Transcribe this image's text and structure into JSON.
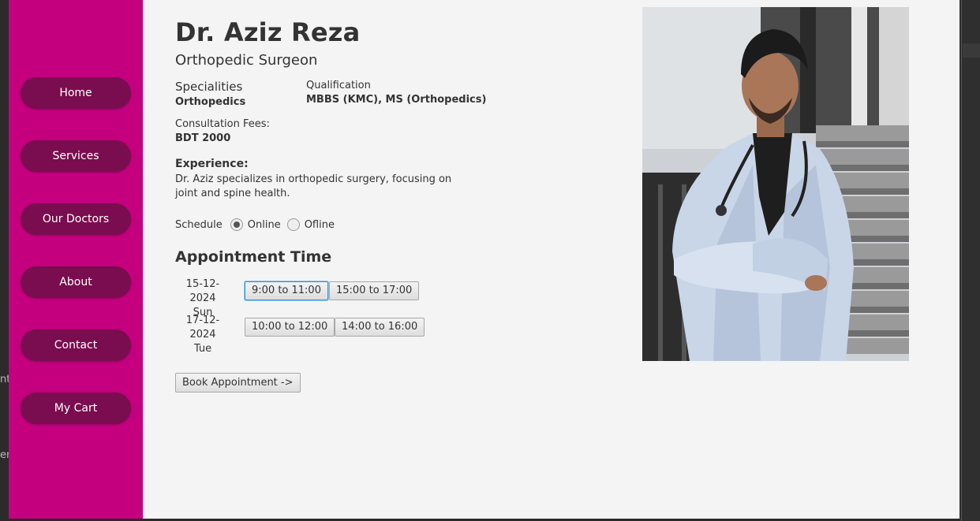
{
  "background": {
    "fragment1": "nt",
    "fragment2": "er"
  },
  "colors": {
    "sidebar": "#c4007f",
    "nav_button": "#7a0d4f",
    "accent_focus": "#3a8fd0"
  },
  "sidebar": {
    "items": [
      {
        "label": "Home"
      },
      {
        "label": "Services"
      },
      {
        "label": "Our Doctors"
      },
      {
        "label": "About"
      },
      {
        "label": "Contact"
      },
      {
        "label": "My Cart"
      }
    ]
  },
  "doctor": {
    "name": "Dr. Aziz Reza",
    "title": "Orthopedic Surgeon",
    "specialities_label": "Specialities",
    "specialities_value": "Orthopedics",
    "qualification_label": "Qualification",
    "qualification_value": "MBBS (KMC), MS (Orthopedics)",
    "fees_label": "Consultation Fees:",
    "fees_value": "BDT 2000",
    "experience_label": "Experience:",
    "experience_text": "Dr. Aziz specializes in orthopedic surgery, focusing on joint and spine health."
  },
  "schedule": {
    "label": "Schedule",
    "options": [
      {
        "label": "Online",
        "checked": true
      },
      {
        "label": "Ofline",
        "checked": false
      }
    ]
  },
  "appointment": {
    "heading": "Appointment Time",
    "days": [
      {
        "date": "15-12-2024",
        "day": "Sun",
        "slots": [
          "9:00 to 11:00",
          "15:00 to 17:00"
        ],
        "selected_slot": "9:00 to 11:00"
      },
      {
        "date": "17-12-2024",
        "day": "Tue",
        "slots": [
          "10:00 to 12:00",
          "14:00 to 16:00"
        ]
      }
    ],
    "book_label": "Book Appointment ->"
  }
}
